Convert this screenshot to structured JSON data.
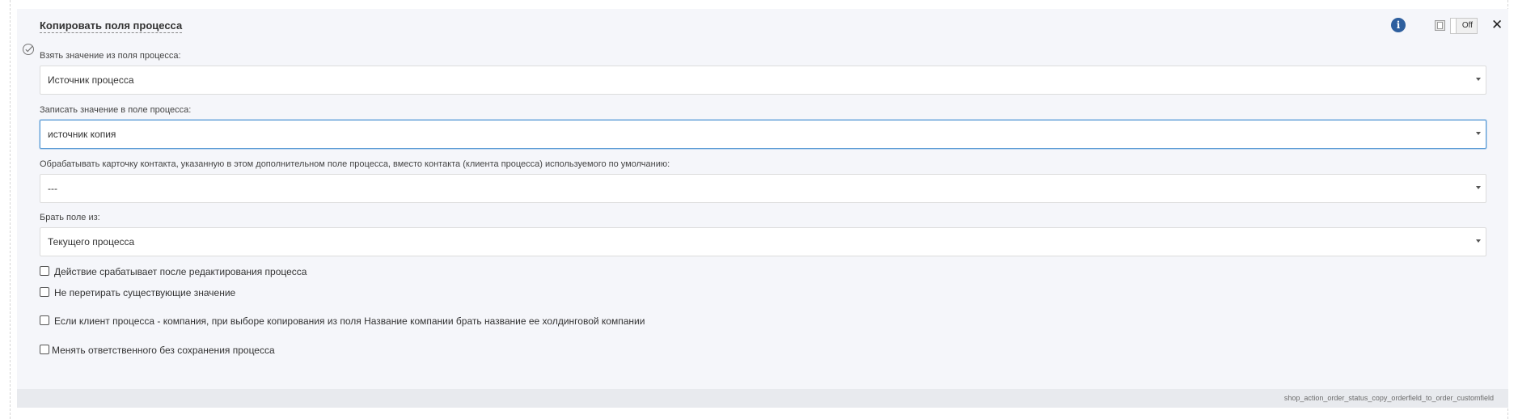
{
  "action": {
    "title": "Копировать поля процесса",
    "toggle_label": "Off",
    "footer_code": "shop_action_order_status_copy_orderfield_to_order_customfield"
  },
  "fields": [
    {
      "label": "Взять значение из поля процесса:",
      "value": "Источник процесса"
    },
    {
      "label": "Записать значение в поле процесса:",
      "value": "источник копия"
    },
    {
      "label": "Обрабатывать карточку контакта, указанную в этом дополнительном поле процесса, вместо контакта (клиента процесса) используемого по умолчанию:",
      "value": "---"
    },
    {
      "label": "Брать поле из:",
      "value": "Текущего процесса"
    }
  ],
  "checkboxes": [
    {
      "label": "Действие срабатывает после редактирования процесса",
      "checked": false
    },
    {
      "label": "Не перетирать существующие значение",
      "checked": false
    },
    {
      "label": "Если клиент процесса - компания, при выборе копирования из поля Название компании брать название ее холдинговой компании",
      "checked": false
    },
    {
      "label": "Менять ответственного без сохранения процесса",
      "checked": false
    }
  ],
  "icons": {
    "status": "check-circle-icon",
    "info": "info-icon",
    "copy": "copy-icon",
    "close": "close-icon"
  },
  "colors": {
    "info": "#2e5f9e",
    "focus_border": "#5b9bd5",
    "card_background": "#f5f6fa"
  }
}
